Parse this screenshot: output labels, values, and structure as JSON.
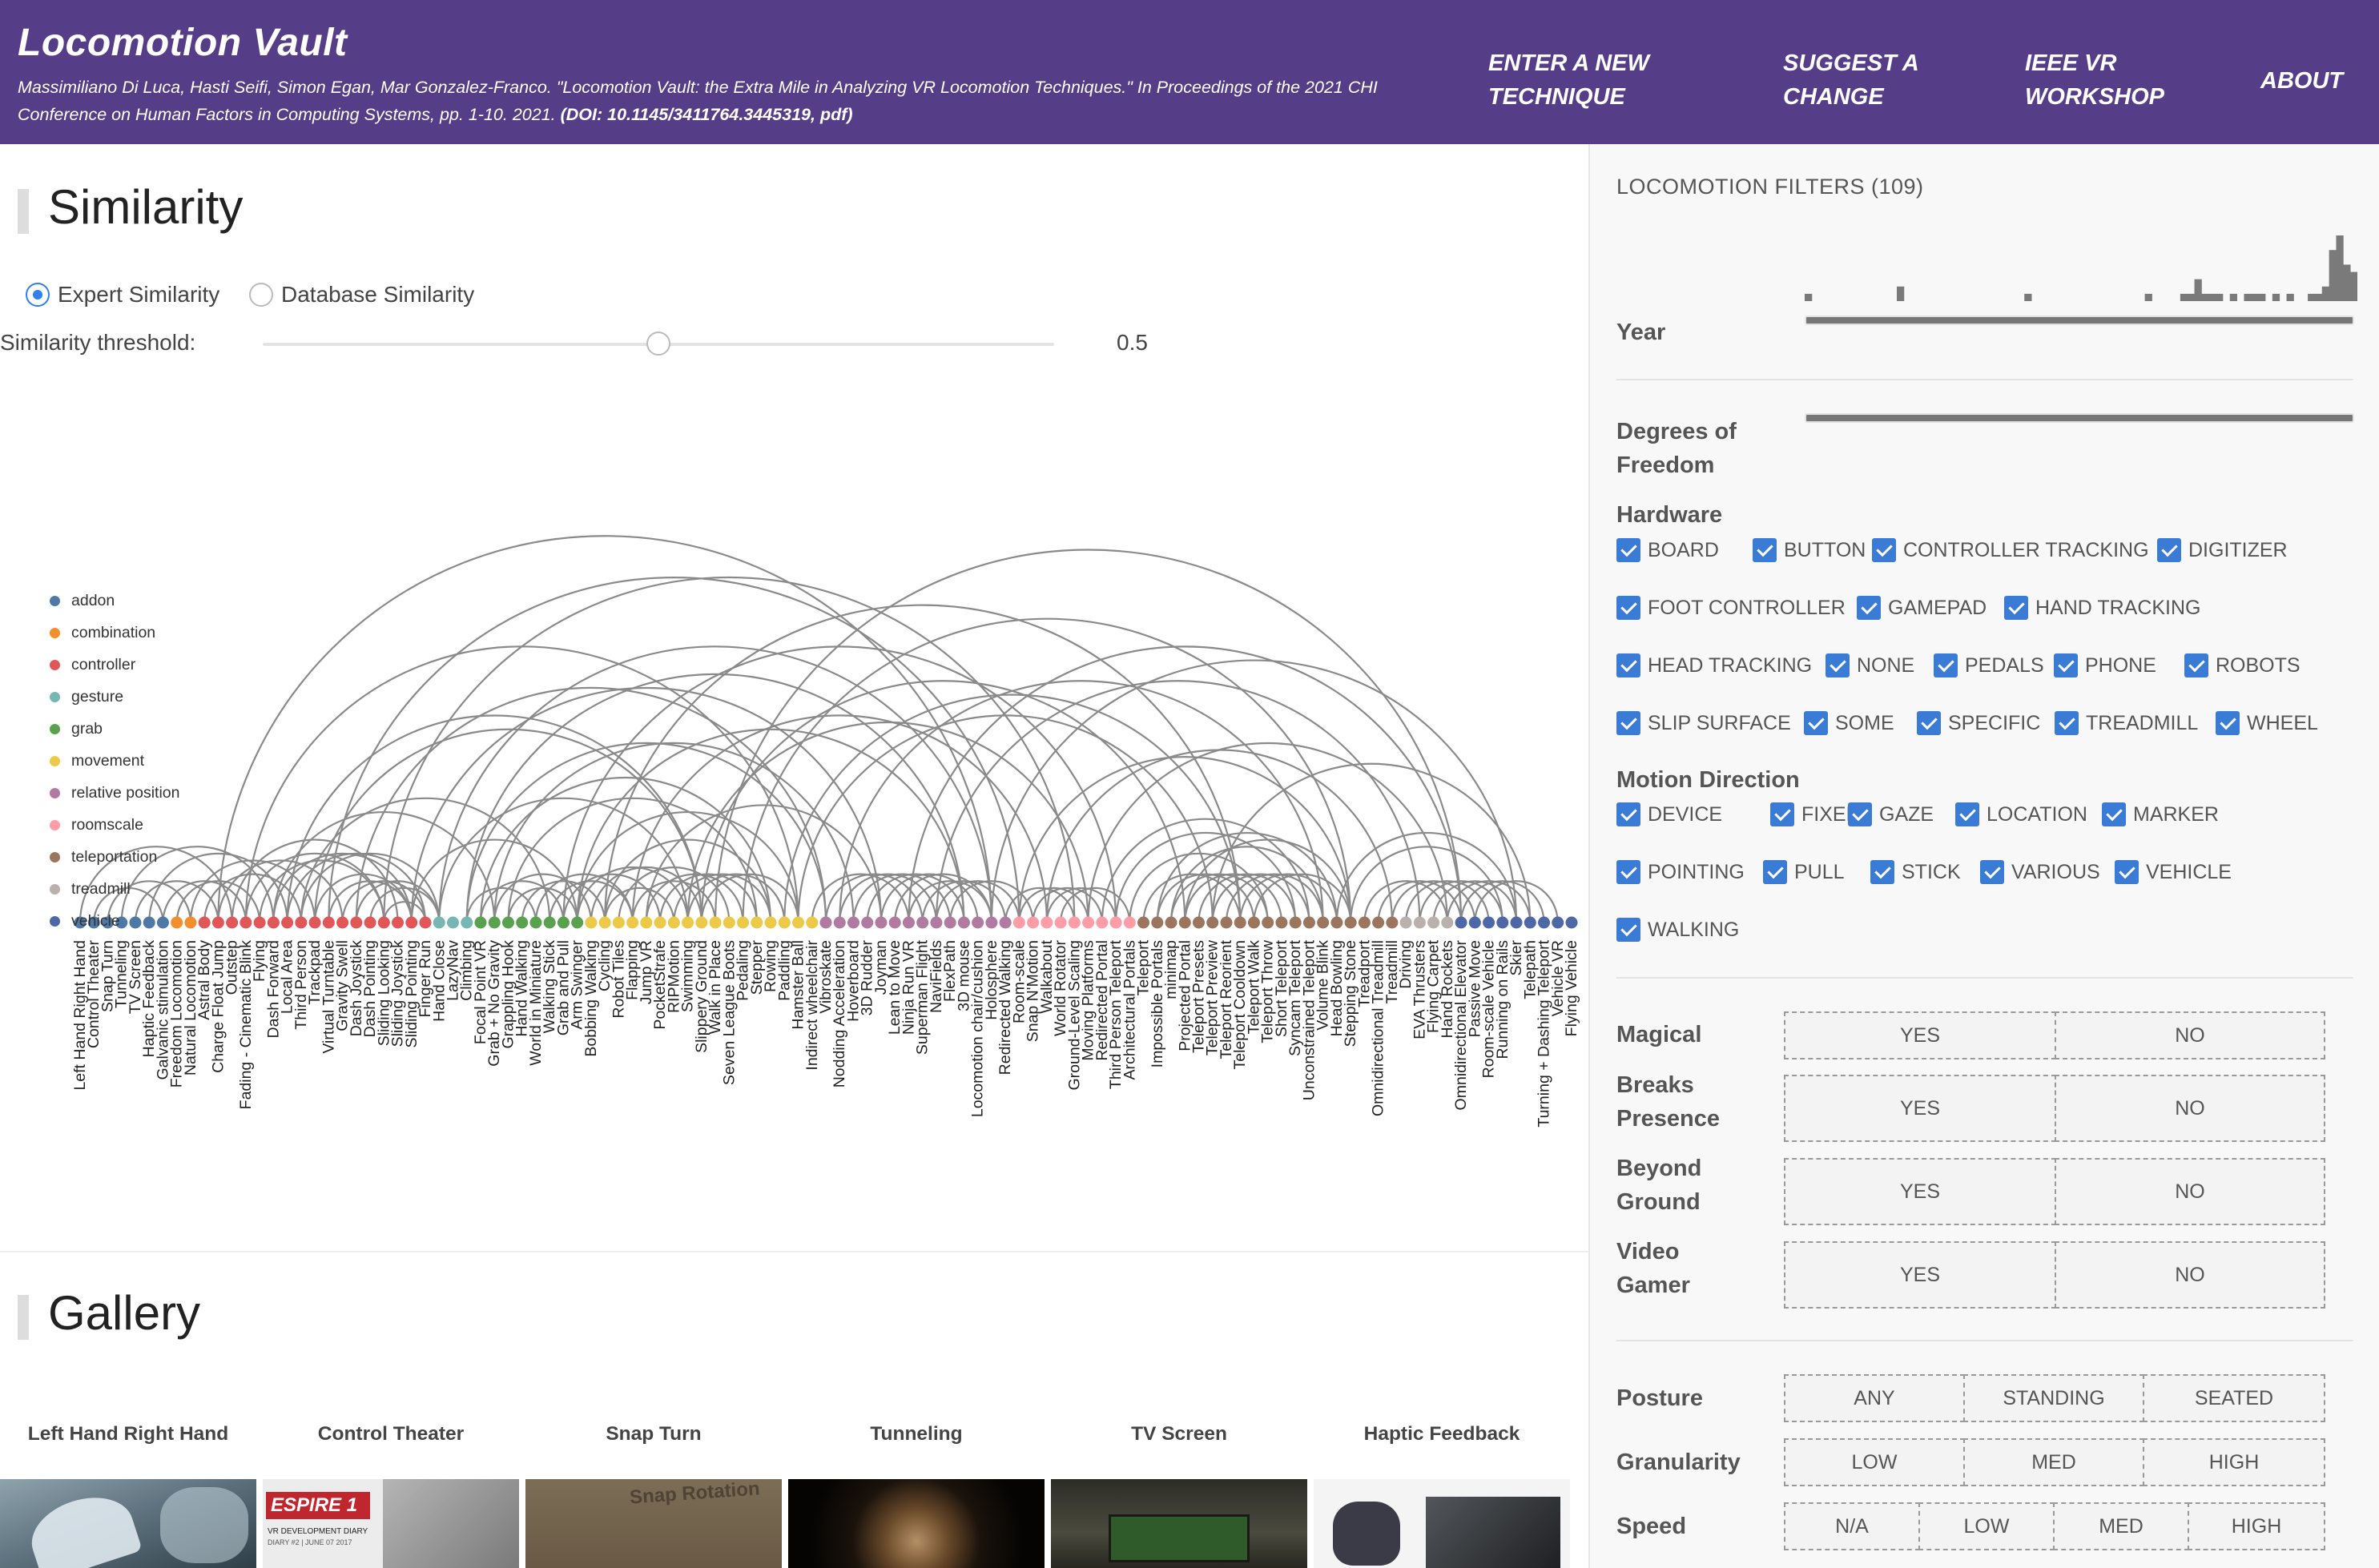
{
  "header": {
    "title": "Locomotion Vault",
    "citation_text": "Massimiliano Di Luca, Hasti Seifi, Simon Egan, Mar Gonzalez-Franco. \"Locomotion Vault: the Extra Mile in Analyzing VR Locomotion Techniques.\" In Proceedings of the 2021 CHI Conference on Human Factors in Computing Systems, pp. 1-10. 2021.",
    "citation_doi": "(DOI: 10.1145/3411764.3445319, pdf)",
    "nav": [
      {
        "line1": "ENTER A NEW",
        "line2": "TECHNIQUE"
      },
      {
        "line1": "SUGGEST A",
        "line2": "CHANGE"
      },
      {
        "line1": "IEEE VR",
        "line2": "WORKSHOP"
      },
      {
        "line1": "ABOUT",
        "line2": ""
      }
    ]
  },
  "similarity": {
    "title": "Similarity",
    "radio_expert": "Expert Similarity",
    "radio_database": "Database Similarity",
    "selected": "Expert Similarity",
    "threshold_label": "Similarity threshold:",
    "threshold_value": "0.5",
    "threshold_fraction": 0.5
  },
  "legend": [
    {
      "name": "addon",
      "color": "#4e79a7"
    },
    {
      "name": "combination",
      "color": "#f28e2b"
    },
    {
      "name": "controller",
      "color": "#e15759"
    },
    {
      "name": "gesture",
      "color": "#76b7b2"
    },
    {
      "name": "grab",
      "color": "#59a14f"
    },
    {
      "name": "movement",
      "color": "#edc948"
    },
    {
      "name": "relative position",
      "color": "#b07aa1"
    },
    {
      "name": "roomscale",
      "color": "#ff9da7"
    },
    {
      "name": "teleportation",
      "color": "#9c755f"
    },
    {
      "name": "treadmill",
      "color": "#bab0ac"
    },
    {
      "name": "vehicle",
      "color": "#4e68a7"
    }
  ],
  "techniques": [
    "Left Hand Right Hand",
    "Control Theater",
    "Snap Turn",
    "Tunneling",
    "TV Screen",
    "Haptic Feedback",
    "Galvanic stimulation",
    "Freedom Locomotion",
    "Natural Locomotion",
    "Astral Body",
    "Charge Float Jump",
    "Outstep",
    "Fading - Cinematic Blink",
    "Flying",
    "Dash Forward",
    "Local Area",
    "Third Person",
    "Trackpad",
    "Virtual Turntable",
    "Gravity Swell",
    "Dash Joystick",
    "Dash Pointing",
    "Sliding Looking",
    "Sliding Joystick",
    "Sliding Pointing",
    "Finger Run",
    "Hand Close",
    "LazyNav",
    "Climbing",
    "Focal Point VR",
    "Grab + No Gravity",
    "Grappling Hook",
    "Hand Walking",
    "World in Miniature",
    "Walking Stick",
    "Grab and Pull",
    "Arm Swinger",
    "Bobbing Walking",
    "Cycling",
    "Robot Tiles",
    "Flapping",
    "Jump VR",
    "PocketStrafe",
    "RIPMotion",
    "Swimming",
    "Slippery Ground",
    "Walk in Place",
    "Seven League Boots",
    "Pedaling",
    "Stepper",
    "Rowing",
    "Paddling",
    "Hamster Ball",
    "Indirect wheelchair",
    "Vibroskate",
    "Nodding Acceleration",
    "Hoverboard",
    "3D Rudder",
    "Joyman",
    "Lean to Move",
    "Ninja Run VR",
    "Superman Flight",
    "NaviFields",
    "FlexPath",
    "3D mouse",
    "Locomotion chair/cushion",
    "Holosphere",
    "Redirected Walking",
    "Room-scale",
    "Snap N'Motion",
    "Walkabout",
    "World Rotator",
    "Ground-Level Scaling",
    "Moving Platforms",
    "Redirected Portal",
    "Third Person Teleport",
    "Architectural Portals",
    "Teleport",
    "Impossible Portals",
    "minimap",
    "Projected Portal",
    "Teleport Presets",
    "Teleport Preview",
    "Teleport Reorient",
    "Teleport Cooldown",
    "Teleport Walk",
    "Teleport Throw",
    "Short Teleport",
    "Syncam Teleport",
    "Unconstrained Teleport",
    "Volume Blink",
    "Head Bowling",
    "Stepping Stone",
    "Treadport",
    "Omnidirectional Treadmill",
    "Treadmill",
    "Driving",
    "EVA Thrusters",
    "Flying Carpet",
    "Hand Rockets",
    "Omnidirectional Elevator",
    "Passive Move",
    "Room-scale Vehicle",
    "Running on Rails",
    "Skier",
    "Telepath",
    "Turning + Dashing Teleport",
    "Vehicle VR",
    "Flying Vehicle"
  ],
  "gallery": {
    "title": "Gallery",
    "cards": [
      "Left Hand Right Hand",
      "Control Theater",
      "Snap Turn",
      "Tunneling",
      "TV Screen",
      "Haptic Feedback"
    ],
    "snap_overlay": "Snap Rotation",
    "espire_logo": "ESPIRE 1",
    "espire_caption": "VR DEVELOPMENT DIARY",
    "espire_caption2": "DIARY #2 | JUNE 07 2017"
  },
  "filters": {
    "title": "LOCOMOTION FILTERS (109)",
    "year_label": "Year",
    "year_histogram": [
      1,
      0,
      0,
      0,
      0,
      0,
      0,
      0,
      0,
      0,
      0,
      0,
      0,
      2,
      0,
      0,
      0,
      0,
      0,
      0,
      0,
      0,
      0,
      0,
      0,
      0,
      0,
      0,
      0,
      0,
      0,
      1,
      0,
      0,
      0,
      0,
      0,
      0,
      0,
      0,
      0,
      0,
      0,
      0,
      0,
      0,
      0,
      0,
      1,
      0,
      0,
      0,
      0,
      1,
      1,
      3,
      1,
      1,
      1,
      0,
      1,
      0,
      1,
      1,
      1,
      0,
      1,
      0,
      1,
      0,
      0,
      1,
      1,
      2,
      7,
      9,
      5,
      4
    ],
    "dof_label_1": "Degrees of",
    "dof_label_2": "Freedom",
    "hardware_label": "Hardware",
    "hardware": [
      "BOARD",
      "BUTTON",
      "CONTROLLER TRACKING",
      "DIGITIZER",
      "FOOT CONTROLLER",
      "GAMEPAD",
      "HAND TRACKING",
      "HEAD TRACKING",
      "NONE",
      "PEDALS",
      "PHONE",
      "ROBOTS",
      "SLIP SURFACE",
      "SOME",
      "SPECIFIC",
      "TREADMILL",
      "WHEEL"
    ],
    "motion_label": "Motion Direction",
    "motion": [
      "DEVICE",
      "FIXED",
      "GAZE",
      "LOCATION",
      "MARKER",
      "POINTING",
      "PULL",
      "STICK",
      "VARIOUS",
      "VEHICLE",
      "WALKING"
    ],
    "magical": "Magical",
    "breaks_1": "Breaks",
    "breaks_2": "Presence",
    "beyond_1": "Beyond",
    "beyond_2": "Ground",
    "video_1": "Video",
    "video_2": "Gamer",
    "yes": "YES",
    "no": "NO",
    "posture_label": "Posture",
    "posture": [
      "ANY",
      "STANDING",
      "SEATED"
    ],
    "granularity_label": "Granularity",
    "granularity": [
      "LOW",
      "MED",
      "HIGH"
    ],
    "speed_label": "Speed",
    "speed": [
      "N/A",
      "LOW",
      "MED",
      "HIGH"
    ]
  }
}
